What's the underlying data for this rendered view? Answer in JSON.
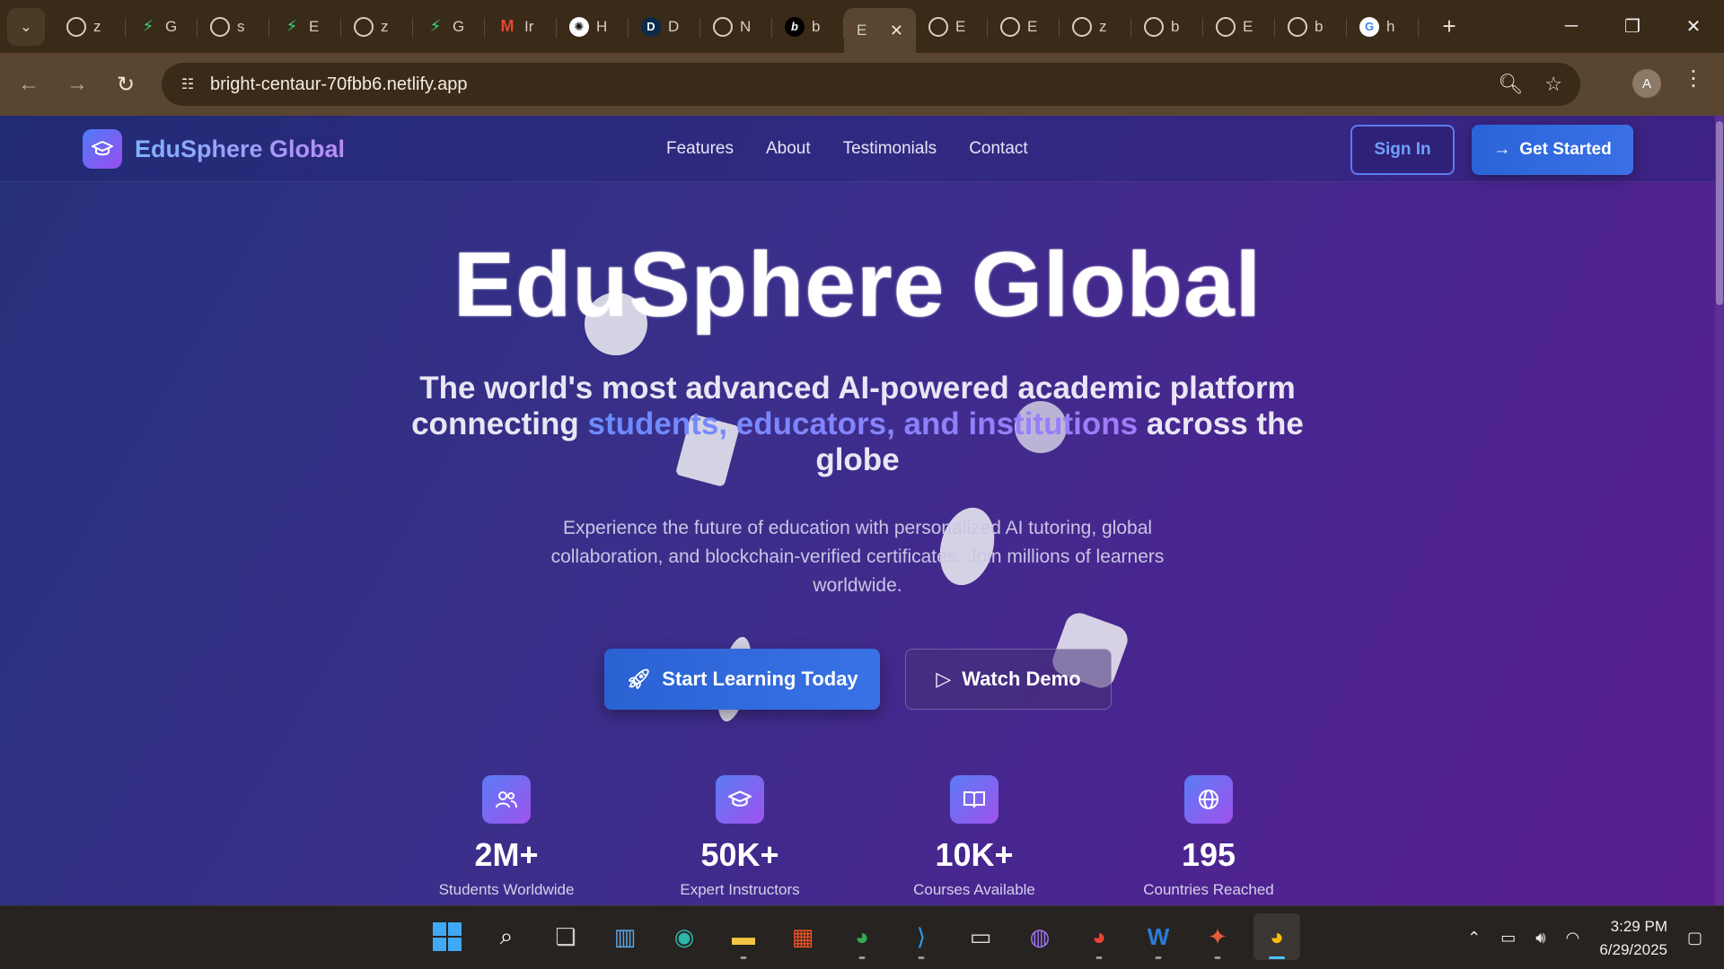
{
  "browser": {
    "tabs": [
      {
        "icon": "globe-icon",
        "label": "z"
      },
      {
        "icon": "bolt-icon",
        "label": "G"
      },
      {
        "icon": "globe-icon",
        "label": "s"
      },
      {
        "icon": "bolt-icon",
        "label": "E"
      },
      {
        "icon": "globe-icon",
        "label": "z"
      },
      {
        "icon": "bolt-icon",
        "label": "G"
      },
      {
        "icon": "gmail-icon",
        "label": "Ir"
      },
      {
        "icon": "openai-icon",
        "label": "H"
      },
      {
        "icon": "d-icon",
        "label": "D"
      },
      {
        "icon": "globe-icon",
        "label": "N"
      },
      {
        "icon": "b-icon",
        "label": "b"
      },
      {
        "icon": "",
        "label": "E",
        "active": true
      },
      {
        "icon": "globe-icon",
        "label": "E"
      },
      {
        "icon": "globe-icon",
        "label": "E"
      },
      {
        "icon": "globe-icon",
        "label": "z"
      },
      {
        "icon": "globe-icon",
        "label": "b"
      },
      {
        "icon": "globe-icon",
        "label": "E"
      },
      {
        "icon": "globe-icon",
        "label": "b"
      },
      {
        "icon": "google-icon",
        "label": "h"
      }
    ],
    "url": "bright-centaur-70fbb6.netlify.app",
    "profile_initial": "A"
  },
  "site": {
    "brand": "EduSphere Global",
    "nav": [
      "Features",
      "About",
      "Testimonials",
      "Contact"
    ],
    "sign_in": "Sign In",
    "get_started": "Get Started",
    "hero_title": "EduSphere Global",
    "hero_sub_before": "The world's most advanced AI-powered academic platform connecting",
    "hero_sub_highlight": "students, educators, and institutions",
    "hero_sub_after": "across the globe",
    "hero_desc": "Experience the future of education with personalized AI tutoring, global collaboration, and blockchain-verified certificates. Join millions of learners worldwide.",
    "cta_primary": "Start Learning Today",
    "cta_secondary": "Watch Demo",
    "stats": [
      {
        "icon": "users-icon",
        "value": "2M+",
        "label": "Students Worldwide"
      },
      {
        "icon": "graduation-cap-icon",
        "value": "50K+",
        "label": "Expert Instructors"
      },
      {
        "icon": "book-icon",
        "value": "10K+",
        "label": "Courses Available"
      },
      {
        "icon": "globe-icon",
        "value": "195",
        "label": "Countries Reached"
      }
    ]
  },
  "taskbar": {
    "time": "3:29 PM",
    "date": "6/29/2025"
  }
}
